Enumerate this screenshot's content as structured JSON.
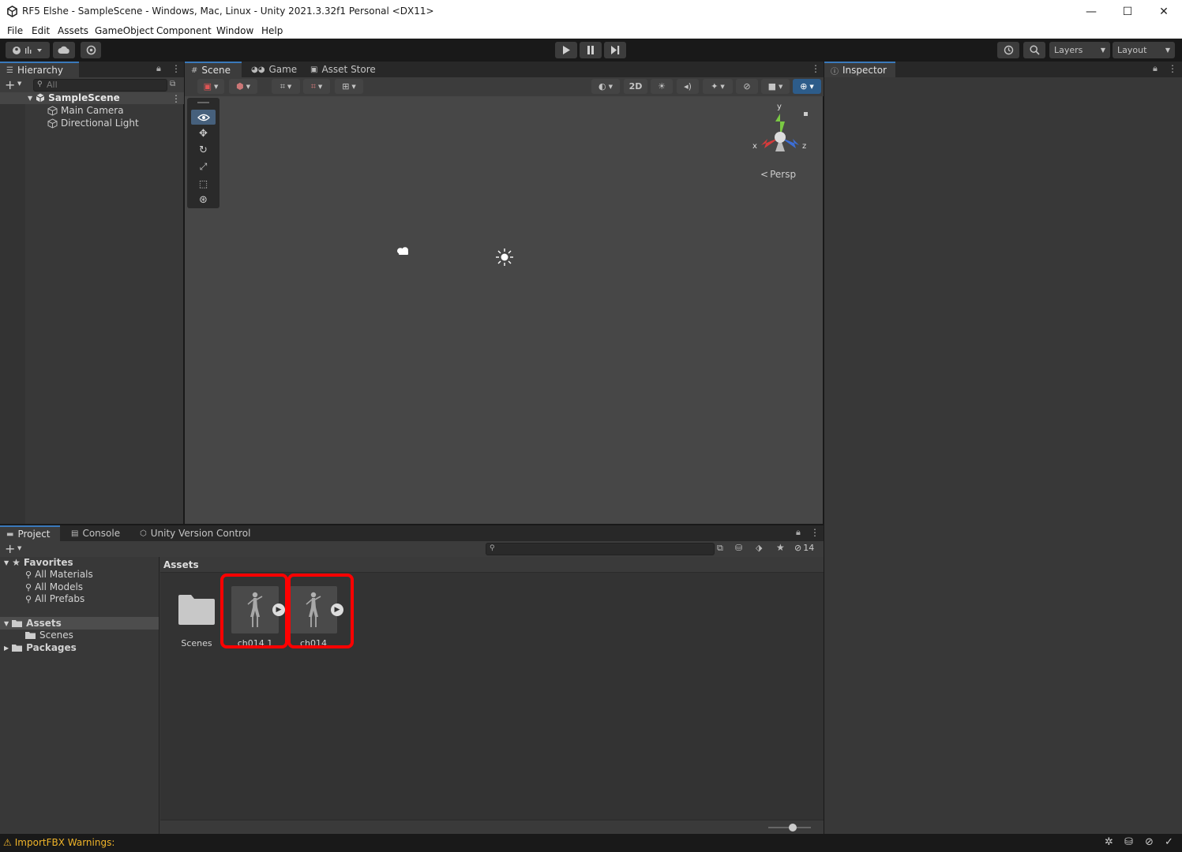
{
  "window": {
    "title": "RF5 Elshe - SampleScene - Windows, Mac, Linux - Unity 2021.3.32f1 Personal <DX11>",
    "minimize": "—",
    "maximize": "☐",
    "close": "✕"
  },
  "menu": [
    "File",
    "Edit",
    "Assets",
    "GameObject",
    "Component",
    "Window",
    "Help"
  ],
  "toolbar": {
    "layers_label": "Layers",
    "layout_label": "Layout"
  },
  "hierarchy": {
    "tab_label": "Hierarchy",
    "search_placeholder": "All",
    "scene_name": "SampleScene",
    "items": [
      "Main Camera",
      "Directional Light"
    ]
  },
  "scene_view": {
    "tabs": [
      "Scene",
      "Game",
      "Asset Store"
    ],
    "mode_2d": "2D",
    "gizmo_axes": {
      "x": "x",
      "y": "y",
      "z": "z"
    },
    "projection_label": "Persp"
  },
  "inspector": {
    "tab_label": "Inspector"
  },
  "project": {
    "tabs": [
      "Project",
      "Console",
      "Unity Version Control"
    ],
    "hidden_count": "14",
    "breadcrumb": "Assets",
    "favorites_label": "Favorites",
    "favorites": [
      "All Materials",
      "All Models",
      "All Prefabs"
    ],
    "assets_label": "Assets",
    "assets_children": [
      "Scenes"
    ],
    "packages_label": "Packages",
    "grid_items": [
      {
        "label": "Scenes",
        "kind": "folder",
        "highlighted": false
      },
      {
        "label": "ch014 1",
        "kind": "model",
        "highlighted": true
      },
      {
        "label": "ch014",
        "kind": "model",
        "highlighted": true
      }
    ]
  },
  "status": {
    "message": "ImportFBX Warnings:",
    "warning_color": "#f0b429"
  },
  "colors": {
    "accent": "#3a79bb",
    "highlight_box": "#ff0000",
    "editor_bg": "#383838",
    "scene_bg": "#474747"
  }
}
